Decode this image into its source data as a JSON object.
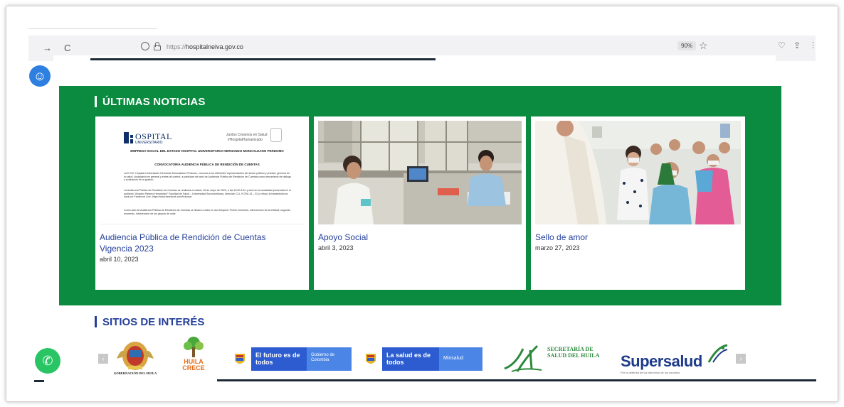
{
  "browser": {
    "back": "←",
    "forward": "→",
    "reload": "C",
    "url_protocol": "https://",
    "url_host": "hospitalneiva.gov.co",
    "zoom": "90%"
  },
  "news": {
    "title": "ÚLTIMAS NOTICIAS",
    "items": [
      {
        "title": "Audiencia Pública de Rendición de Cuentas Vigencia 2023",
        "date": "abril 10, 2023",
        "doc": {
          "logo_word": "OSPITAL",
          "logo_sub": "UNIVERSITARIO",
          "tagline1": "Juntos Creamos en Salud",
          "tagline2": "#HospitalHumanizado",
          "heading": "EMPRESA SOCIAL DEL ESTADO HOSPITAL UNIVERSITARIO HERNANDO MONCALEANO PERDOMO",
          "subheading": "CONVOCATORIA AUDIENCIA PÚBLICA DE RENDICIÓN DE CUENTAS",
          "para1": "La E.S.E. Hospital Universitario Hernando Moncaleano Perdomo, convoca a los diferentes representantes del sector público y privado, gremios de la salud, ciudadanía en general y entes de control, a participar del acto de Audiencia Pública de Rendición de Cuentas como mecanismo de diálogo y evaluación de la gestión.",
          "para2": "La Audiencia Pública de Rendición de Cuentas se realizará el martes 16 de mayo de 2023, a las 10:00 A.M. y será en la modalidad presencial en el auditorio \"Amparo Páramo Hernández\" Facultad de Salud – Universidad Surcolombiana, dirección CLL 9 CRA 14 – 02 y virtual, la transmisión se hará por Facebook Live: https://www.facebook.com/huhmpn",
          "para3": "Como acto de Audiencia Pública de Rendición de Cuentas se llevará a cabo en dos bloques: Primer momento, intervención de la entidad; segundo momento, intervención de los grupos de valor."
        }
      },
      {
        "title": "Apoyo Social",
        "date": "abril 3, 2023"
      },
      {
        "title": "Sello de amor",
        "date": "marzo 27, 2023"
      }
    ]
  },
  "sites": {
    "title": "SITIOS DE INTERÉS",
    "gobernacion_caption": "GOBERNACIÓN DEL HUILA",
    "huila_crece": "HUILA CRECE",
    "futuro_main": "El futuro es de todos",
    "futuro_sub": "Gobierno de Colombia",
    "salud_main": "La salud es de todos",
    "salud_sub": "Minsalud",
    "secretaria": "SECRETARÍA DE SALUD DEL HUILA",
    "supersalud": "Supersalud",
    "supersalud_tagline": "Por la defensa de los derechos de los usuarios"
  },
  "colors": {
    "green": "#0a8b3f",
    "blue_text": "#243f9a",
    "gov_blue": "#2c5ccf"
  }
}
